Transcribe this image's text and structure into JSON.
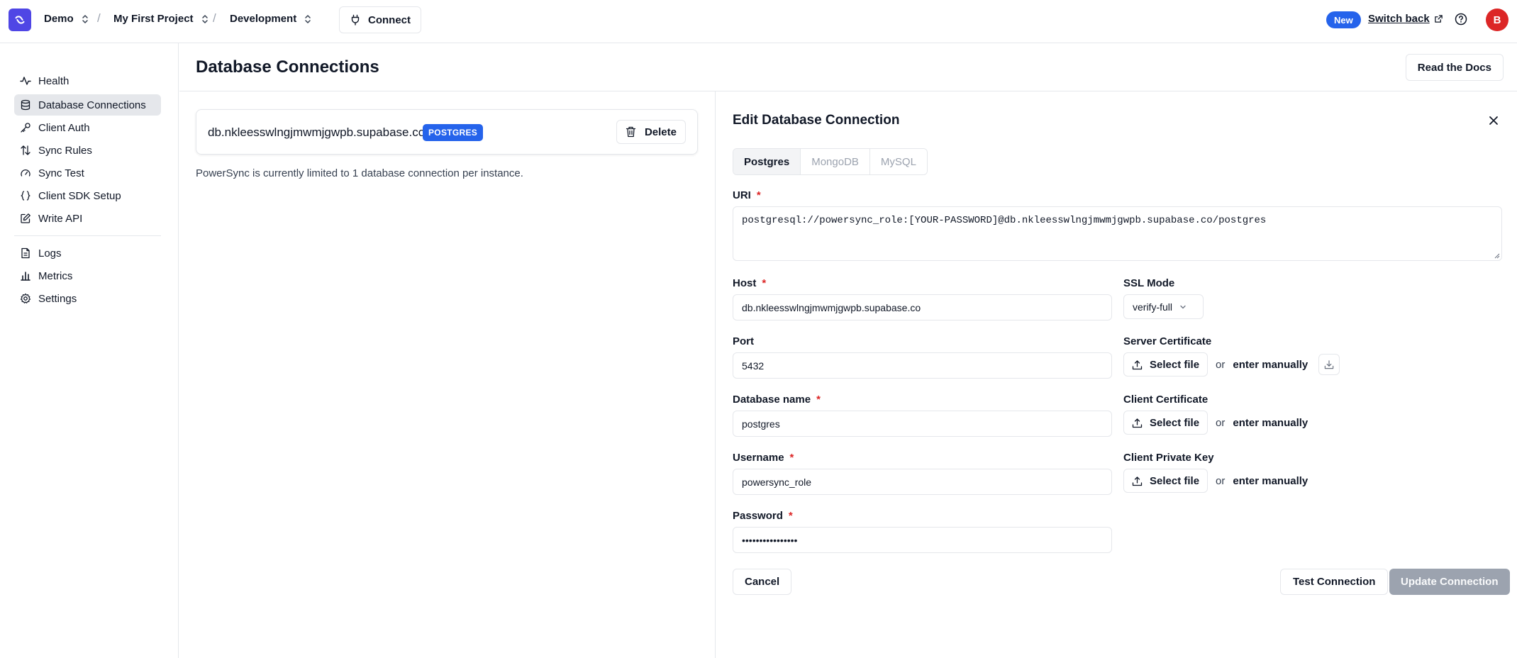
{
  "topbar": {
    "org": "Demo",
    "project": "My First Project",
    "instance": "Development",
    "separator": "/",
    "connect_label": "Connect",
    "new_badge": "New",
    "switch_back": "Switch back",
    "avatar_initial": "B"
  },
  "sidebar": {
    "items": [
      {
        "label": "Health",
        "icon": "activity-icon"
      },
      {
        "label": "Database Connections",
        "icon": "database-icon",
        "active": true
      },
      {
        "label": "Client Auth",
        "icon": "key-icon"
      },
      {
        "label": "Sync Rules",
        "icon": "arrows-up-down-icon"
      },
      {
        "label": "Sync Test",
        "icon": "gauge-icon"
      },
      {
        "label": "Client SDK Setup",
        "icon": "braces-icon"
      },
      {
        "label": "Write API",
        "icon": "edit-icon"
      },
      {
        "label": "Logs",
        "icon": "file-text-icon"
      },
      {
        "label": "Metrics",
        "icon": "bar-chart-icon"
      },
      {
        "label": "Settings",
        "icon": "gear-icon"
      }
    ]
  },
  "page": {
    "title": "Database Connections",
    "docs_label": "Read the Docs"
  },
  "connection": {
    "host": "db.nkleesswlngjmwmjgwpb.supabase.co",
    "type_badge": "POSTGRES",
    "delete_label": "Delete",
    "limit_note": "PowerSync is currently limited to 1 database connection per instance."
  },
  "edit": {
    "title": "Edit Database Connection",
    "tabs": [
      {
        "label": "Postgres",
        "active": true
      },
      {
        "label": "MongoDB"
      },
      {
        "label": "MySQL"
      }
    ],
    "uri_label": "URI",
    "uri_value": "postgresql://powersync_role:[YOUR-PASSWORD]@db.nkleesswlngjmwmjgwpb.supabase.co/postgres",
    "host_label": "Host",
    "host_value": "db.nkleesswlngjmwmjgwpb.supabase.co",
    "ssl_label": "SSL Mode",
    "ssl_value": "verify-full",
    "port_label": "Port",
    "port_value": "5432",
    "dbname_label": "Database name",
    "dbname_value": "postgres",
    "username_label": "Username",
    "username_value": "powersync_role",
    "password_label": "Password",
    "password_value": "••••••••••••••••",
    "required_mark": "*",
    "server_cert_label": "Server Certificate",
    "client_cert_label": "Client Certificate",
    "client_key_label": "Client Private Key",
    "select_file": "Select file",
    "or": "or",
    "enter_manually": "enter manually",
    "cancel_label": "Cancel",
    "test_label": "Test Connection",
    "update_label": "Update Connection"
  },
  "colors": {
    "brand": "#4f46e5",
    "accent_blue": "#2563eb",
    "required": "#dc2626",
    "avatar": "#dc2626",
    "disabled_button": "#9ca3af"
  }
}
